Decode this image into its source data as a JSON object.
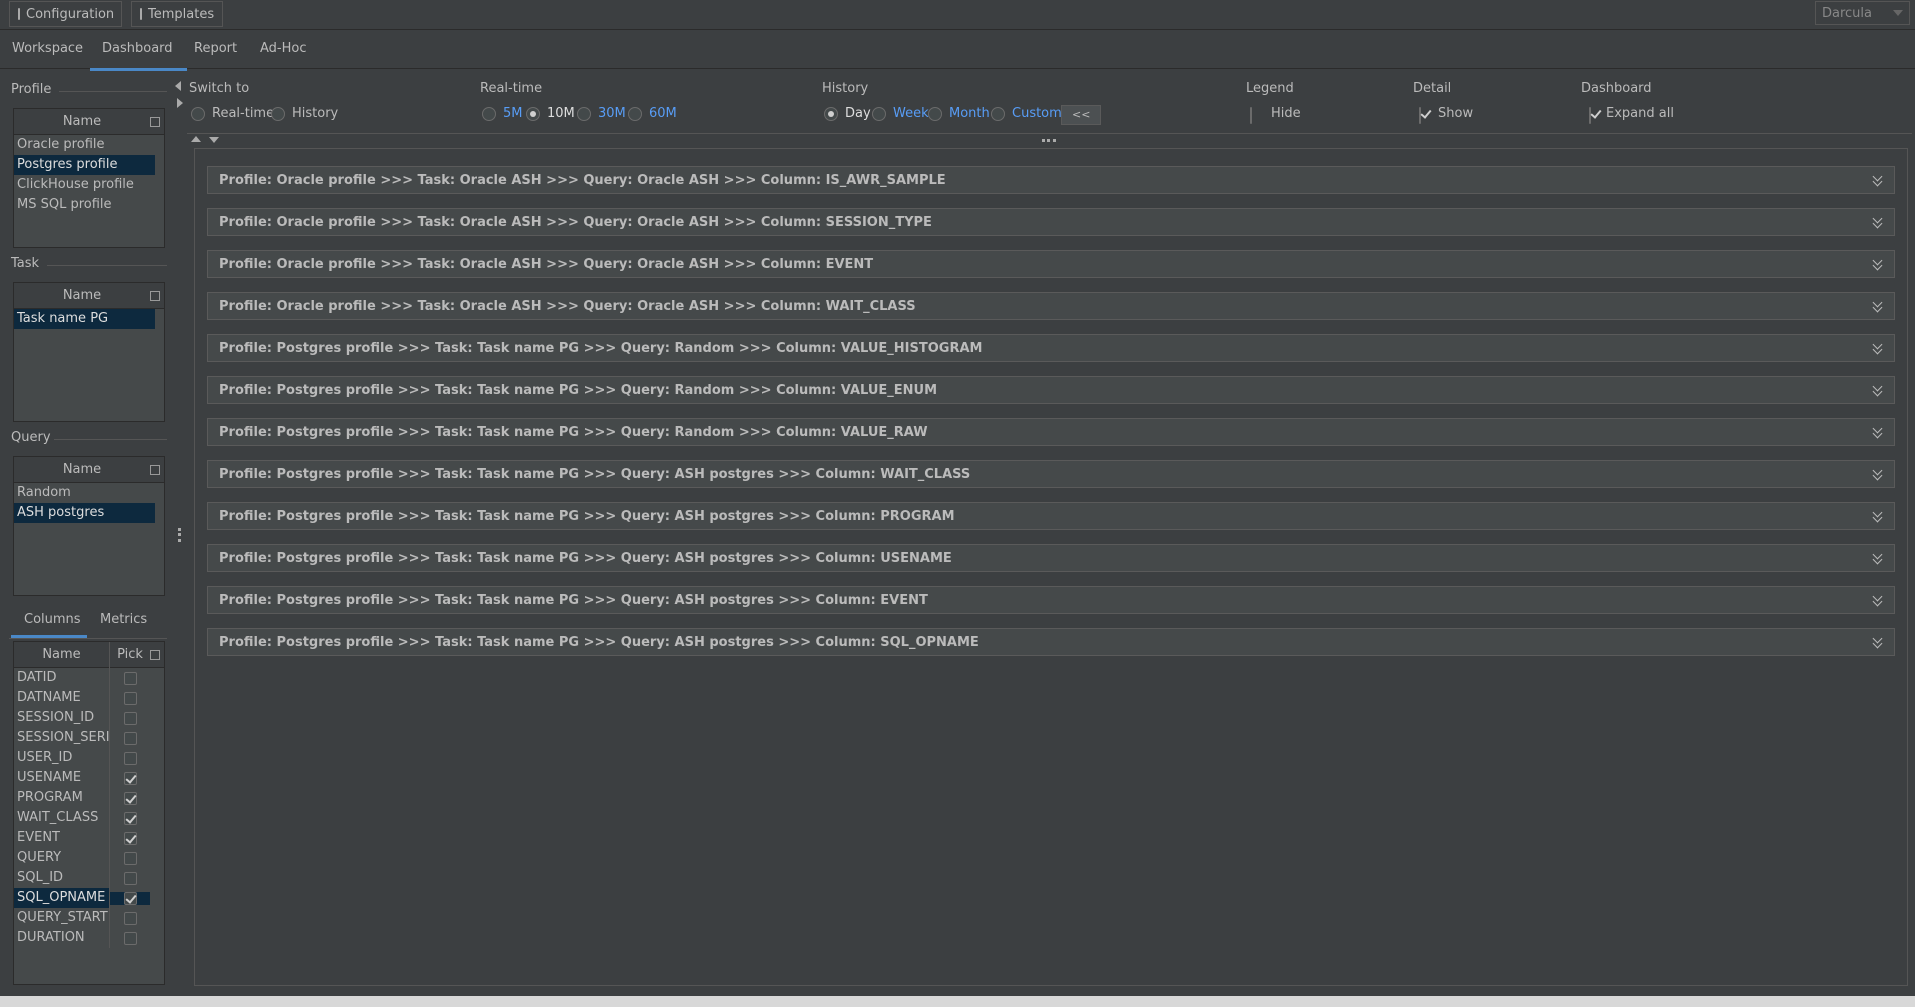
{
  "toolbar": {
    "configuration_label": "Configuration",
    "templates_label": "Templates",
    "theme_value": "Darcula"
  },
  "main_tabs": [
    {
      "label": "Workspace"
    },
    {
      "label": "Dashboard"
    },
    {
      "label": "Report"
    },
    {
      "label": "Ad-Hoc"
    }
  ],
  "profile": {
    "title": "Profile",
    "header": "Name",
    "items": [
      "Oracle profile",
      "Postgres profile",
      "ClickHouse profile",
      "MS SQL profile"
    ],
    "selected": "Postgres profile"
  },
  "task": {
    "title": "Task",
    "header": "Name",
    "items": [
      "Task name PG"
    ],
    "selected": "Task name PG"
  },
  "query": {
    "title": "Query",
    "header": "Name",
    "items": [
      "Random",
      "ASH postgres"
    ],
    "selected": "ASH postgres"
  },
  "columns_tabs": [
    {
      "label": "Columns"
    },
    {
      "label": "Metrics"
    }
  ],
  "columns_table": {
    "header_name": "Name",
    "header_pick": "Pick",
    "rows": [
      {
        "name": "DATID",
        "pick": false
      },
      {
        "name": "DATNAME",
        "pick": false
      },
      {
        "name": "SESSION_ID",
        "pick": false
      },
      {
        "name": "SESSION_SERI...",
        "pick": false
      },
      {
        "name": "USER_ID",
        "pick": false
      },
      {
        "name": "USENAME",
        "pick": true
      },
      {
        "name": "PROGRAM",
        "pick": true
      },
      {
        "name": "WAIT_CLASS",
        "pick": true
      },
      {
        "name": "EVENT",
        "pick": true
      },
      {
        "name": "QUERY",
        "pick": false
      },
      {
        "name": "SQL_ID",
        "pick": false
      },
      {
        "name": "SQL_OPNAME",
        "pick": true
      },
      {
        "name": "QUERY_START",
        "pick": false
      },
      {
        "name": "DURATION",
        "pick": false
      }
    ],
    "selected": "SQL_OPNAME"
  },
  "controls": {
    "switch_to": {
      "title": "Switch to",
      "options": [
        "Real-time",
        "History"
      ],
      "selected": null
    },
    "realtime": {
      "title": "Real-time",
      "options": [
        "5M",
        "10M",
        "30M",
        "60M"
      ],
      "selected": "10M"
    },
    "history": {
      "title": "History",
      "options": [
        "Day",
        "Week",
        "Month",
        "Custom"
      ],
      "selected": "Day",
      "back_button": "<<"
    },
    "legend": {
      "title": "Legend",
      "option": "Hide",
      "checked": false
    },
    "detail": {
      "title": "Detail",
      "option": "Show",
      "checked": true
    },
    "dashboard": {
      "title": "Dashboard",
      "option": "Expand all",
      "checked": true
    }
  },
  "dashboard_panels": [
    "Profile: Oracle profile >>> Task: Oracle ASH >>> Query: Oracle ASH >>> Column: IS_AWR_SAMPLE",
    "Profile: Oracle profile >>> Task: Oracle ASH >>> Query: Oracle ASH >>> Column: SESSION_TYPE",
    "Profile: Oracle profile >>> Task: Oracle ASH >>> Query: Oracle ASH >>> Column: EVENT",
    "Profile: Oracle profile >>> Task: Oracle ASH >>> Query: Oracle ASH >>> Column: WAIT_CLASS",
    "Profile: Postgres profile >>> Task: Task name PG >>> Query: Random >>> Column: VALUE_HISTOGRAM",
    "Profile: Postgres profile >>> Task: Task name PG >>> Query: Random >>> Column: VALUE_ENUM",
    "Profile: Postgres profile >>> Task: Task name PG >>> Query: Random >>> Column: VALUE_RAW",
    "Profile: Postgres profile >>> Task: Task name PG >>> Query: ASH postgres >>> Column: WAIT_CLASS",
    "Profile: Postgres profile >>> Task: Task name PG >>> Query: ASH postgres >>> Column: PROGRAM",
    "Profile: Postgres profile >>> Task: Task name PG >>> Query: ASH postgres >>> Column: USENAME",
    "Profile: Postgres profile >>> Task: Task name PG >>> Query: ASH postgres >>> Column: EVENT",
    "Profile: Postgres profile >>> Task: Task name PG >>> Query: ASH postgres >>> Column: SQL_OPNAME"
  ],
  "colors": {
    "background": "#3c3f41",
    "selection": "#0d293e",
    "accent": "#4a88c7",
    "link": "#589df6"
  }
}
